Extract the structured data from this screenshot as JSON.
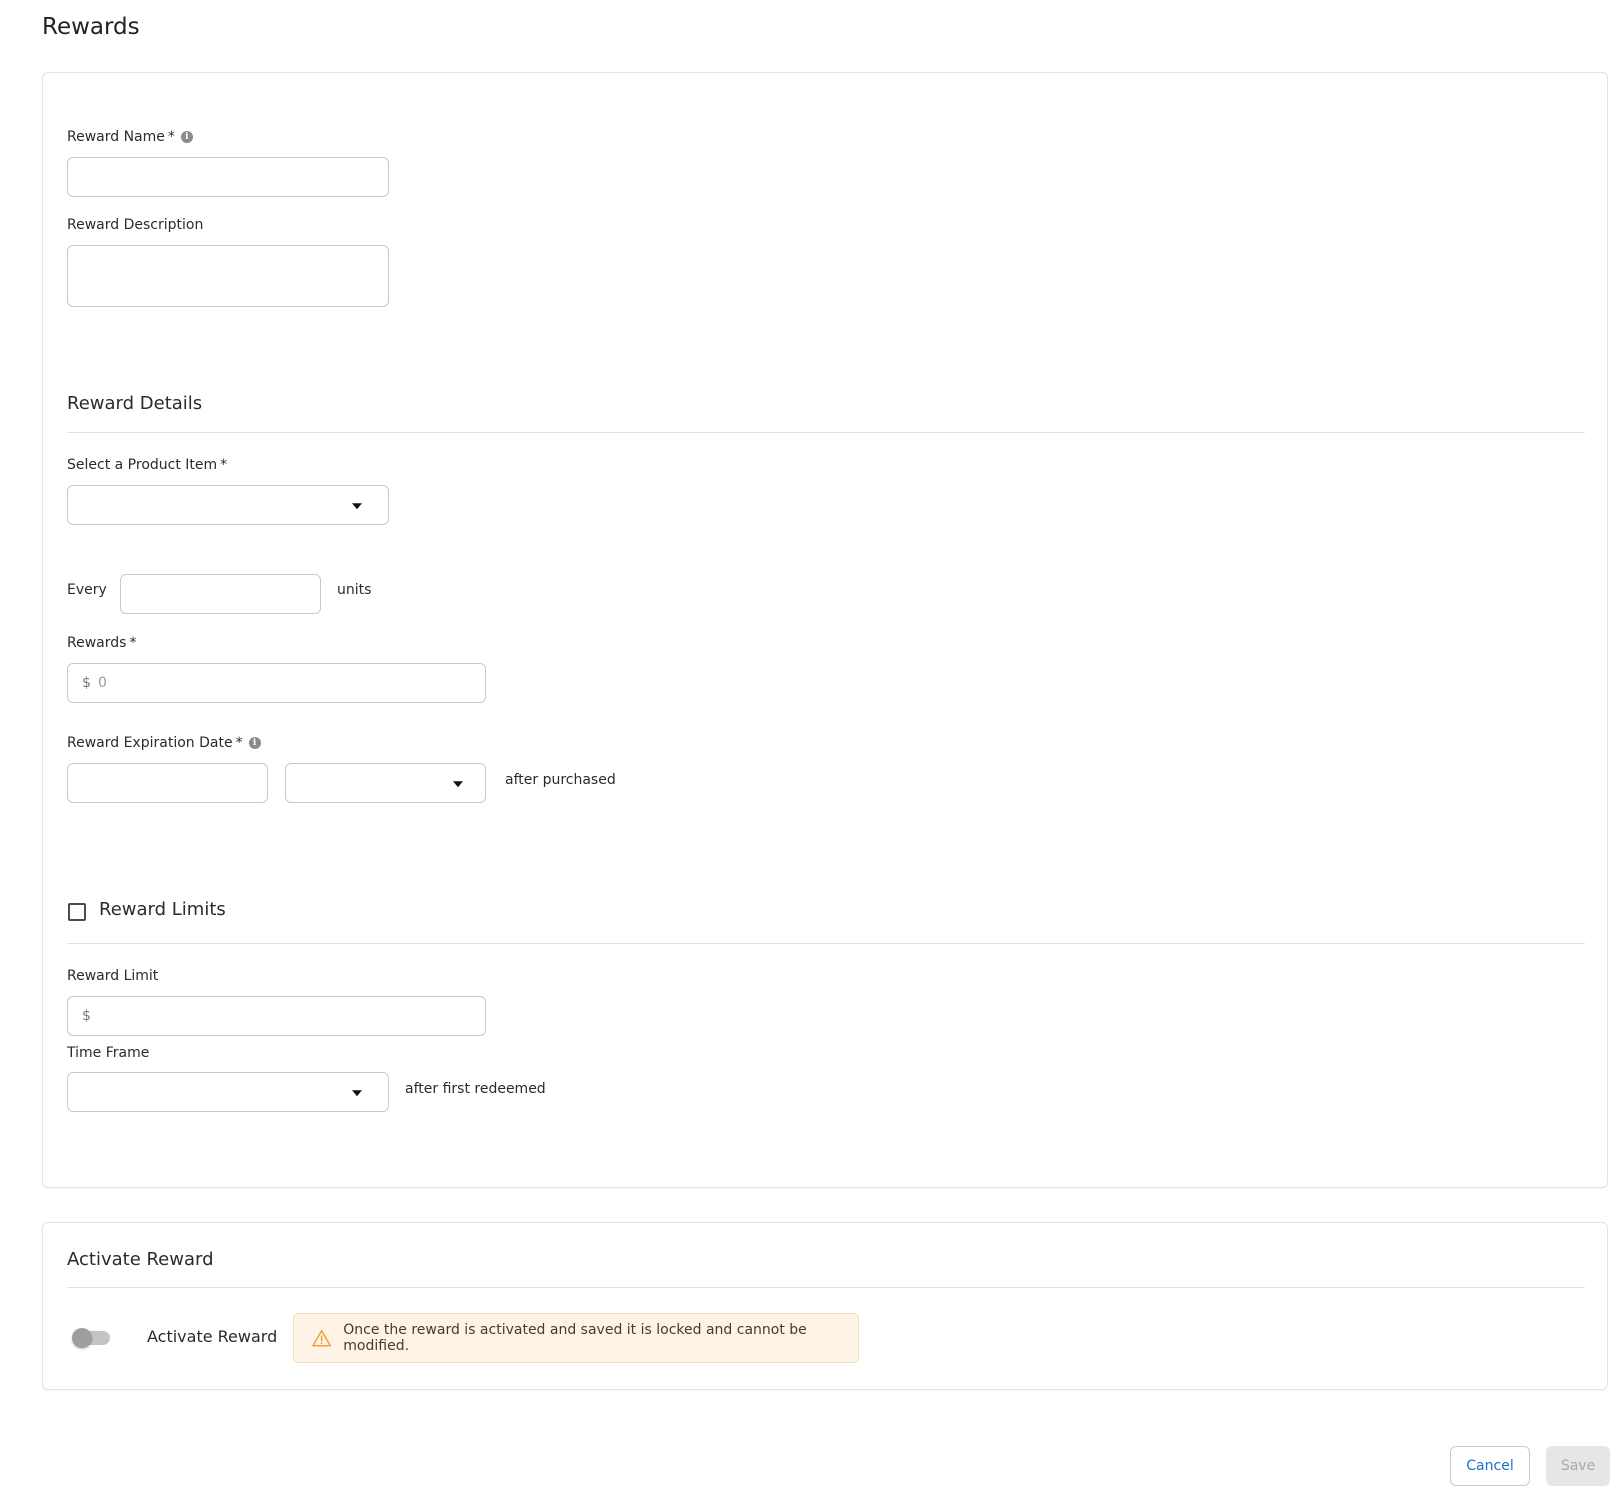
{
  "page": {
    "title": "Rewards"
  },
  "reward_form": {
    "reward_name": {
      "label": "Reward Name",
      "required_mark": "*",
      "value": ""
    },
    "reward_description": {
      "label": "Reward Description",
      "value": ""
    }
  },
  "reward_details": {
    "title": "Reward Details",
    "product_item": {
      "label": "Select a Product Item",
      "required_mark": "*",
      "value": ""
    },
    "every": {
      "label": "Every",
      "value": "",
      "suffix": "units"
    },
    "rewards": {
      "label": "Rewards",
      "required_mark": "*",
      "prefix": "$",
      "placeholder": "0"
    },
    "expiration": {
      "label": "Reward Expiration Date",
      "required_mark": "*",
      "amount": "",
      "unit": "",
      "suffix": "after purchased"
    }
  },
  "reward_limits": {
    "title": "Reward Limits",
    "checked": false,
    "reward_limit": {
      "label": "Reward Limit",
      "prefix": "$",
      "value": ""
    },
    "time_frame": {
      "label": "Time Frame",
      "value": "",
      "suffix": "after first redeemed"
    }
  },
  "activate": {
    "title": "Activate Reward",
    "toggle_label": "Activate Reward",
    "enabled": false,
    "warning": "Once the reward is activated and saved it is locked and cannot be modified.",
    "warning_color": "#f0a33a"
  },
  "footer": {
    "cancel_label": "Cancel",
    "save_label": "Save",
    "cancel_color": "#1f6fc9"
  },
  "icons": {
    "info": "info-icon",
    "warning": "warning-triangle-icon",
    "caret": "caret-down-icon"
  }
}
